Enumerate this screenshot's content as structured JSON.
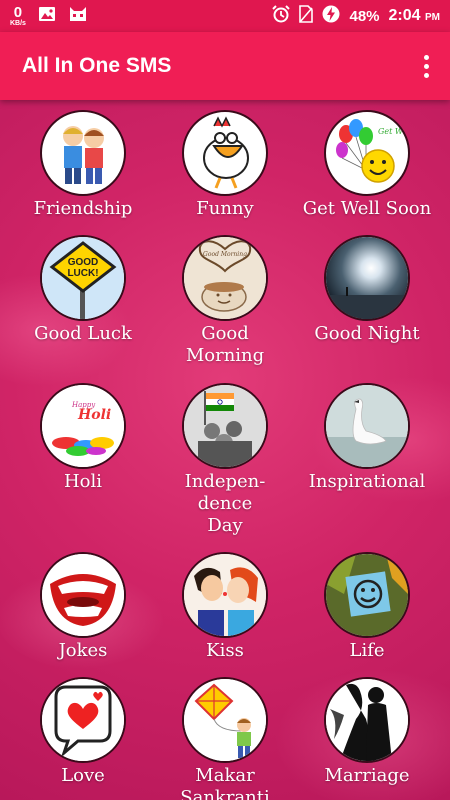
{
  "status_bar": {
    "net_speed": "0",
    "net_unit": "KB/s",
    "battery": "48%",
    "time": "2:04",
    "ampm": "PM"
  },
  "app_bar": {
    "title": "All In One SMS"
  },
  "colors": {
    "app_bar": "#f01e55",
    "status_bar": "#e0174f",
    "background": "#d02466"
  },
  "categories": [
    {
      "label": "Friendship",
      "icon": "friendship-icon"
    },
    {
      "label": "Funny",
      "icon": "funny-chicken-icon"
    },
    {
      "label": "Get Well Soon",
      "icon": "balloons-smiley-icon"
    },
    {
      "label": "Good Luck",
      "icon": "good-luck-sign-icon"
    },
    {
      "label": "Good\nMorning",
      "icon": "coffee-cup-icon"
    },
    {
      "label": "Good Night",
      "icon": "moon-night-icon"
    },
    {
      "label": "Holi",
      "icon": "holi-colors-icon"
    },
    {
      "label": "Indepen-\ndence\nDay",
      "icon": "india-flag-icon"
    },
    {
      "label": "Inspirational",
      "icon": "swan-icon"
    },
    {
      "label": "Jokes",
      "icon": "laughing-mouth-icon"
    },
    {
      "label": "Kiss",
      "icon": "kissing-couple-icon"
    },
    {
      "label": "Life",
      "icon": "smiley-note-icon"
    },
    {
      "label": "Love",
      "icon": "love-speech-bubble-icon"
    },
    {
      "label": "Makar\nSankranti",
      "icon": "kite-icon"
    },
    {
      "label": "Marriage",
      "icon": "couple-silhouette-icon"
    }
  ]
}
